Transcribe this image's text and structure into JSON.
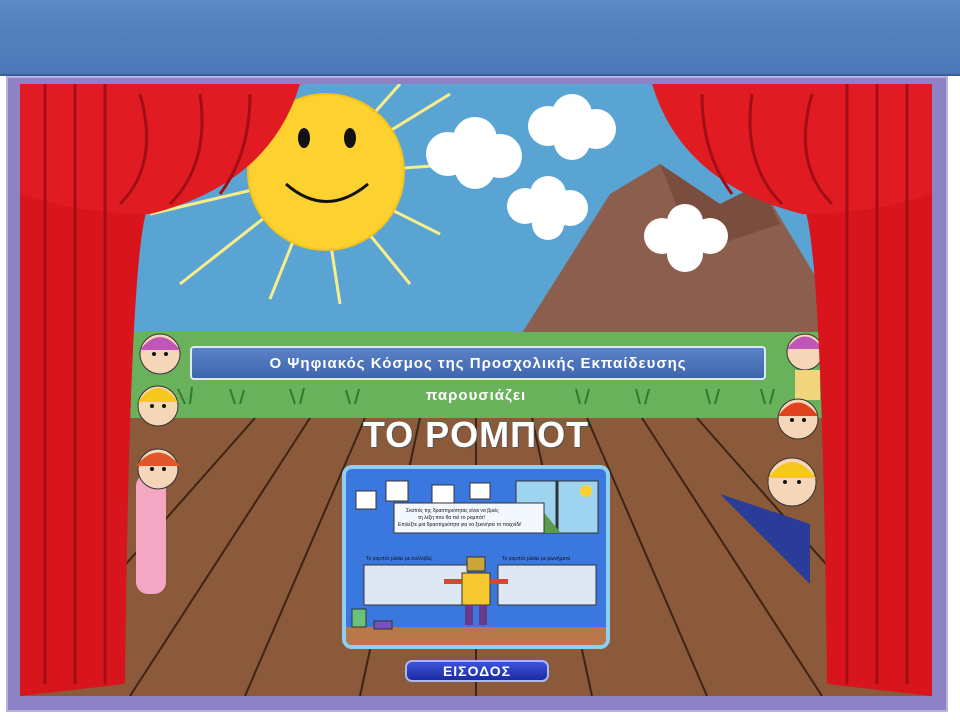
{
  "window": {},
  "stage": {
    "banner_text": "Ο Ψηφιακός Κόσμος της Προσχολικής Εκπαίδευσης",
    "presents_text": "παρουσιάζει",
    "title": "ΤΟ ΡΟΜΠΟΤ",
    "preview": {
      "instruction_lines": [
        "Σκοπός της δραστηριότητας είναι να βρείς",
        "τη λέξη που θα πεί το ρομπότ!",
        "Επιλέξτε μια δραστηριότητα για να ξεκινήσει το παιχνίδι!"
      ],
      "option_syllables": "Το ρομπότ μιλάει με συλλαβές",
      "option_phonemes": "Το ρομπότ μιλάει με φωνήματα"
    },
    "enter_button": "ΕΙΣΟΔΟΣ"
  },
  "colors": {
    "topbar": "#4f7cbd",
    "frame": "#8e82c6",
    "curtain": "#d8141c",
    "sky": "#5aa4d4",
    "floor": "#8a5a3a",
    "banner": "#4a72bb",
    "button": "#2a3ccf"
  }
}
